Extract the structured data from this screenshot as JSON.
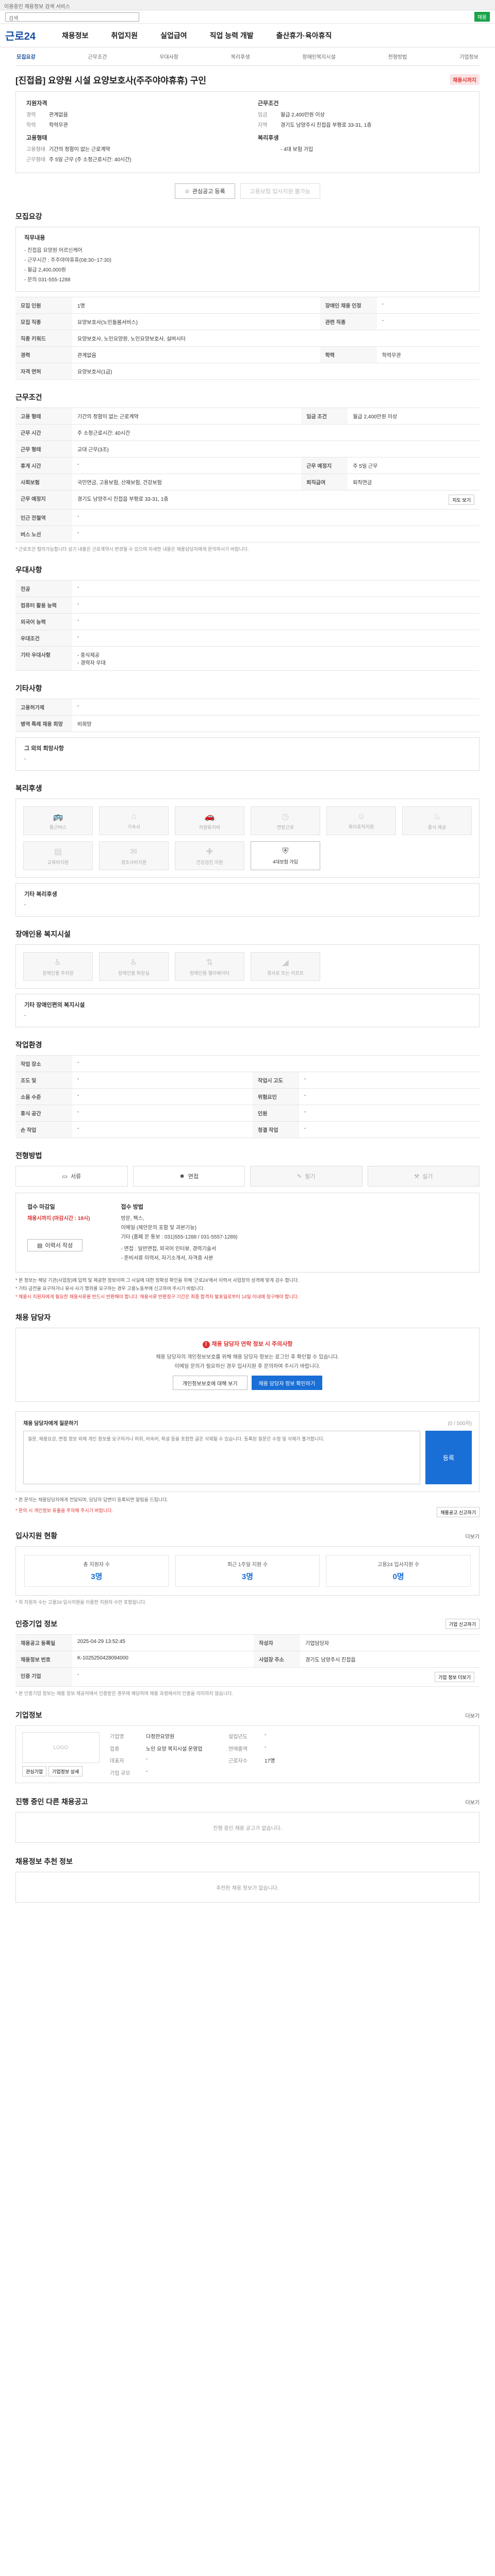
{
  "topbar": {
    "notice": "이용중인 채용정보 검색 서비스"
  },
  "top": {
    "search_placeholder": "검색",
    "green_label": "채용"
  },
  "brand": {
    "logo": "근로24"
  },
  "gnb": [
    "채용정보",
    "취업지원",
    "실업급여",
    "직업 능력 개발",
    "출산휴가·육아휴직"
  ],
  "subnav": {
    "items": [
      "모집요강",
      "근무조건",
      "우대사항",
      "복리후생",
      "장애인복지시설",
      "전형방법",
      "기업정보"
    ],
    "active_index": 0
  },
  "job": {
    "title": "[진접읍] 요양원 시설 요양보호사(주주야야휴휴) 구인",
    "badge": "채용시까지",
    "summary": {
      "left_label": "지원자격",
      "left": [
        {
          "k": "경력",
          "v": "관계없음"
        },
        {
          "k": "학력",
          "v": "학력무관"
        }
      ],
      "left_label2": "고용형태",
      "left2": [
        {
          "k": "고용형태",
          "v": "기간의 정함이 없는 근로계약"
        },
        {
          "k": "근무형태",
          "v": "주 5일 근무 (주 소정근로시간: 40시간)"
        }
      ],
      "right_label": "근무조건",
      "right": [
        {
          "k": "임금",
          "v": "월급 2,400만원 이상"
        },
        {
          "k": "지역",
          "v": "경기도 남양주시 진접읍 부평로 33-31, 1층"
        }
      ],
      "right_label2": "복리후생",
      "right2": [
        {
          "k": "",
          "v": "- 4대 보험 가입"
        }
      ]
    },
    "buttons": {
      "scrap": "관심공고 등록",
      "apply": "고용보험 입사지원 불가능"
    }
  },
  "sections": {
    "recruit": "모집요강",
    "condition": "근무조건",
    "pref": "우대사항",
    "etc": "기타사항",
    "welfare": "복리후생",
    "disabled": "장애인용 복지시설",
    "env": "작업환경",
    "process": "전형방법",
    "contact": "채용 담당자",
    "stats": "입사지원 현황",
    "cert": "인증기업 정보",
    "company": "기업정보",
    "other_jobs": "진행 중인 다른 채용공고",
    "recommend": "채용정보 추천 정보"
  },
  "recruit": {
    "box_title": "직무내용",
    "box_lines": [
      "- 진접읍 요양원 어르신케어",
      "- 근무시간 : 주주야야휴휴(08:30~17:30)",
      "- 월급 2,400,000원",
      "- 문의 031-555-1288"
    ],
    "rows": [
      {
        "k": "모집 인원",
        "v": "1명",
        "k2": "장애인 채용 인정",
        "v2": "-"
      },
      {
        "k": "모집 직종",
        "v": "요양보호사(노인돌봄서비스)",
        "k2": "관련 직종",
        "v2": "-"
      },
      {
        "k": "직종 키워드",
        "v": "요양보호사, 노인요양원, 노인요양보호사, 실버시터",
        "k2": "",
        "v2": ""
      },
      {
        "k": "경력",
        "v": "관계없음",
        "k2": "학력",
        "v2": "학력무관"
      },
      {
        "k": "자격 면허",
        "v": "요양보호사(1급)",
        "k2": "",
        "v2": ""
      }
    ]
  },
  "condition": {
    "rows": [
      {
        "k": "고용 형태",
        "v": "기간의 정함이 없는 근로계약",
        "k2": "임금 조건",
        "v2": "월급 2,400만원 이상"
      },
      {
        "k": "근무 시간",
        "v": "주 소정근로시간: 40시간",
        "k2": "",
        "v2": ""
      },
      {
        "k": "근무 형태",
        "v": "교대 근무(3조)",
        "k2": "",
        "v2": ""
      },
      {
        "k": "휴게 시간",
        "v": "-",
        "k2": "근무 예정지",
        "v2": "주 5일 근무"
      },
      {
        "k": "사회보험",
        "v": "국민연금, 고용보험, 산재보험, 건강보험",
        "k2": "퇴직급여",
        "v2": "퇴직연금"
      },
      {
        "k": "근무 예정지",
        "v": "경기도 남양주시 진접읍 부평로 33-31, 1층",
        "k2": "",
        "v2": ""
      },
      {
        "k": "인근 전철역",
        "v": "-",
        "k2": "",
        "v2": ""
      },
      {
        "k": "버스 노선",
        "v": "-",
        "k2": "",
        "v2": ""
      }
    ],
    "map_btn": "지도 보기",
    "note": "* 근로조건 협의가능합니다 상기 내용은 근로계약시 변경될 수 있으며 자세한 내용은 채용담당자에게 문의하시기 바랍니다."
  },
  "pref": {
    "rows": [
      {
        "k": "전공",
        "v": "-"
      },
      {
        "k": "컴퓨터 활용 능력",
        "v": "-"
      },
      {
        "k": "외국어 능력",
        "v": "-"
      },
      {
        "k": "우대조건",
        "v": "-"
      },
      {
        "k": "기타 우대사항",
        "v": "- 중식제공\n- 경력자 우대"
      }
    ]
  },
  "etc": {
    "rows": [
      {
        "k": "고용허가제",
        "v": "-"
      },
      {
        "k": "병역 특례 채용 희망",
        "v": "비희망"
      }
    ],
    "note_label": "그 외의 희망사항",
    "note_value": "-"
  },
  "welfare": {
    "items": [
      {
        "icon": "car-icon",
        "label": "통근버스",
        "on": false
      },
      {
        "icon": "house-icon",
        "label": "기숙사",
        "on": false
      },
      {
        "icon": "food-icon",
        "label": "차량유지비",
        "on": false
      },
      {
        "icon": "chair-icon",
        "label": "연장근로",
        "on": false
      },
      {
        "icon": "baby-icon",
        "label": "육아휴직지원",
        "on": false
      },
      {
        "icon": "gift-icon",
        "label": "중식 제공",
        "on": false
      },
      {
        "icon": "training-icon",
        "label": "교육비지원",
        "on": false
      },
      {
        "icon": "cake-icon",
        "label": "경조사비지원",
        "on": false
      },
      {
        "icon": "flower-icon",
        "label": "건강검진 지원",
        "on": false
      },
      {
        "icon": "shield-icon",
        "label": "4대보험 가입",
        "on": true
      }
    ],
    "other_label": "기타 복리후생",
    "other_value": "-"
  },
  "disabled": {
    "items": [
      {
        "icon": "wheelchair-icon",
        "label": "장애인용 주차장"
      },
      {
        "icon": "toilet-icon",
        "label": "장애인용 화장실"
      },
      {
        "icon": "elevator-icon",
        "label": "장애인용 엘리베이터"
      },
      {
        "icon": "ramp-icon",
        "label": "경사로 또는 리프트"
      }
    ],
    "other_label": "기타 장애인편의 복지시설",
    "other_value": "-"
  },
  "env": {
    "rows": [
      {
        "k": "작업 장소",
        "v": "-",
        "k2": "",
        "v2": ""
      },
      {
        "k": "조도 및",
        "v": "-",
        "k2": "작업시 고도",
        "v2": "-"
      },
      {
        "k": "소음 수준",
        "v": "-",
        "k2": "위험요인",
        "v2": "-"
      },
      {
        "k": "휴식 공간",
        "v": "-",
        "k2": "인원",
        "v2": "-"
      },
      {
        "k": "손 작업",
        "v": "-",
        "k2": "청결 작업",
        "v2": "-"
      }
    ]
  },
  "process": {
    "steps": [
      "서류",
      "면접",
      "필기",
      "실기"
    ],
    "step_on": [
      true,
      true,
      false,
      false
    ],
    "doc_label": "접수 마감일",
    "doc_value": "채용시까지 (마감시간 : 18시)",
    "doc_btn": "이력서 작성",
    "method_label": "접수 방법",
    "method_lines": [
      "방문, 팩스,",
      "이메일 (제안문의 포함 및 과본기능)",
      "기타 (홈페 문 통보 : 031)555-1288 / 031-5557-1289)"
    ],
    "etc_lines": [
      "- 면접 : 일반면접, 외국어 인터뷰, 경력기술서",
      "- 준비서류 이력서, 자기소개서, 자격증 사본"
    ],
    "notes": [
      "* 본 정보는 해당 기관(사업장)에 입력 및 제공한 정보이며 그 사실에 대한 정확성 확인을 위해 '근로24'에서 이력서 사업장의 성격에 맞게 검수 합니다.",
      "* 기타 금전을 요구하거나 유사 사기 행위를 요구하는 경우 고용노동부에 신고하여 주시기 바랍니다.",
      "* 채용시 지원자에게 필요한 채용서류를 반드시 반환해야 합니다. 채용서류 반환청구 기간은 최종 합격자 발표일로부터 14일 이내에 청구해야 합니다."
    ]
  },
  "contact": {
    "warn_title": "채용 담당자 연락 정보 시 주의사항",
    "desc1": "채용 담당자의 개인정보보호를 위해 채용 담당자 정보는 로그인 후 확인할 수 있습니다.",
    "desc2": "이메일 문의가 필요하신 경우 입사지원 후 문의하여 주시기 바랍니다.",
    "btn1": "개인정보보호에 대해 보기",
    "btn2": "채용 담당자 정보 확인하기"
  },
  "qna": {
    "title": "채용 담당자에게 질문하기",
    "count": "(0 / 500자)",
    "placeholder": "질문, 채용요강, 면접 정보 외에 개인 정보를 요구하거나 허위, 비속어, 욕설 등을 포함한 글은 삭제될 수 있습니다. 등록된 질문은 수정 및 삭제가 불가합니다.",
    "submit": "등록",
    "note1": "* 본 문의는 채용담당자에게 전달되며, 담당자 답변이 등록되면 알림을 드립니다.",
    "note2": "* 문의 시 개인정보 유출을 주의해 주시기 바랍니다.",
    "btn": "채용공고 신고하기"
  },
  "stats": {
    "items": [
      {
        "label": "총 지원자 수",
        "value": "3명"
      },
      {
        "label": "최근 1주일 지원 수",
        "value": "3명"
      },
      {
        "label": "고용24 입사지원 수",
        "value": "0명"
      }
    ],
    "more": "더보기",
    "note": "* 위 지원자 수는 고용24 입사지원을 이용한 지원자 수만 포함됩니다."
  },
  "cert": {
    "rows": [
      {
        "k": "채용공고 등록일",
        "v": "2025-04-29 13:52:45",
        "k2": "작성자",
        "v2": "기업담당자"
      },
      {
        "k": "채용정보 번호",
        "v": "K-1025250428094000",
        "k2": "사업장 주소",
        "v2": "경기도 남양주시 진접읍"
      },
      {
        "k": "인증 기업",
        "v": "-",
        "k2": "",
        "v2": ""
      }
    ],
    "note": "* 본 인증기업 정보는 채용 정보 제공처에서 인증받은 경우에 해당하며 채용 과정에서의 인증을 의미하지 않습니다.",
    "btn": "기업 정보 더보기",
    "right_btn": "기업 신고하기"
  },
  "company": {
    "logo_text": "LOGO",
    "rows": [
      {
        "k": "기업명",
        "v": "다정한요양원",
        "k2": "설립년도",
        "v2": "-"
      },
      {
        "k": "업종",
        "v": "노인 요양 복지시설 운영업",
        "k2": "연매출액",
        "v2": "-"
      },
      {
        "k": "대표자",
        "v": "-",
        "k2": "근로자수",
        "v2": "17명"
      },
      {
        "k": "기업 규모",
        "v": "-",
        "k2": "",
        "v2": ""
      }
    ],
    "btns": [
      "관심기업",
      "기업정보 상세"
    ],
    "more": "더보기"
  },
  "other_jobs": {
    "empty": "진행 중인 채용 공고가 없습니다.",
    "more": "더보기"
  },
  "recommend": {
    "empty": "추천된 채용 정보가 없습니다."
  }
}
